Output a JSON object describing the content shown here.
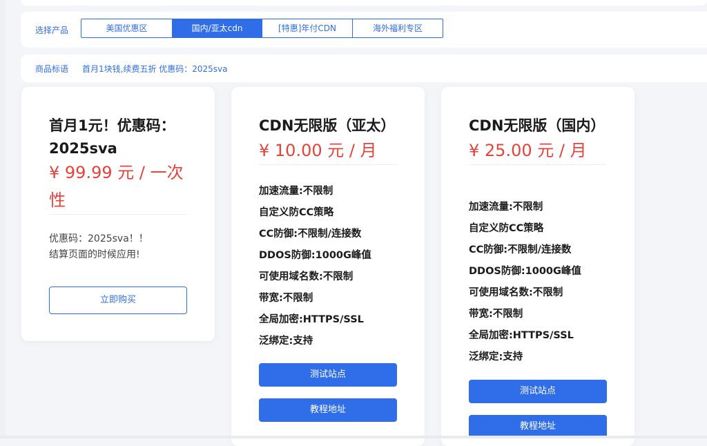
{
  "colors": {
    "accent": "#2f6ee8",
    "price": "#e8413a",
    "background": "#f4f5f9"
  },
  "product_bar": {
    "label": "选择产品",
    "tabs": [
      {
        "label": "美国优惠区",
        "active": false
      },
      {
        "label": "国内/亚太cdn",
        "active": true
      },
      {
        "label": "[特惠]年付CDN",
        "active": false
      },
      {
        "label": "海外福利专区",
        "active": false
      }
    ]
  },
  "tagline": {
    "label": "商品标语",
    "text": "首月1块钱,续费五折 优惠码：2025sva"
  },
  "cards": [
    {
      "title_line1": "首月1元！优惠码：",
      "title_line2": "2025sva",
      "price_line1": "¥ 99.99 元 / 一次",
      "price_line2": "性",
      "note_line1": "优惠码：2025sva！！",
      "note_line2": "结算页面的时候应用!",
      "buy_label": "立即购买"
    },
    {
      "title": "CDN无限版（亚太）",
      "price": "¥ 10.00 元 / 月",
      "features": [
        "加速流量:不限制",
        "自定义防CC策略",
        "CC防御:不限制/连接数",
        "DDOS防御:1000G峰值",
        "可使用域名数:不限制",
        "带宽:不限制",
        "全局加密:HTTPS/SSL",
        "泛绑定:支持"
      ],
      "test_label": "测试站点",
      "tutorial_label": "教程地址"
    },
    {
      "title": "CDN无限版（国内）",
      "price": "¥ 25.00 元 / 月",
      "features": [
        "加速流量:不限制",
        "自定义防CC策略",
        "CC防御:不限制/连接数",
        "DDOS防御:1000G峰值",
        "可使用域名数:不限制",
        "带宽:不限制",
        "全局加密:HTTPS/SSL",
        "泛绑定:支持"
      ],
      "test_label": "测试站点",
      "tutorial_label": "教程地址"
    }
  ]
}
